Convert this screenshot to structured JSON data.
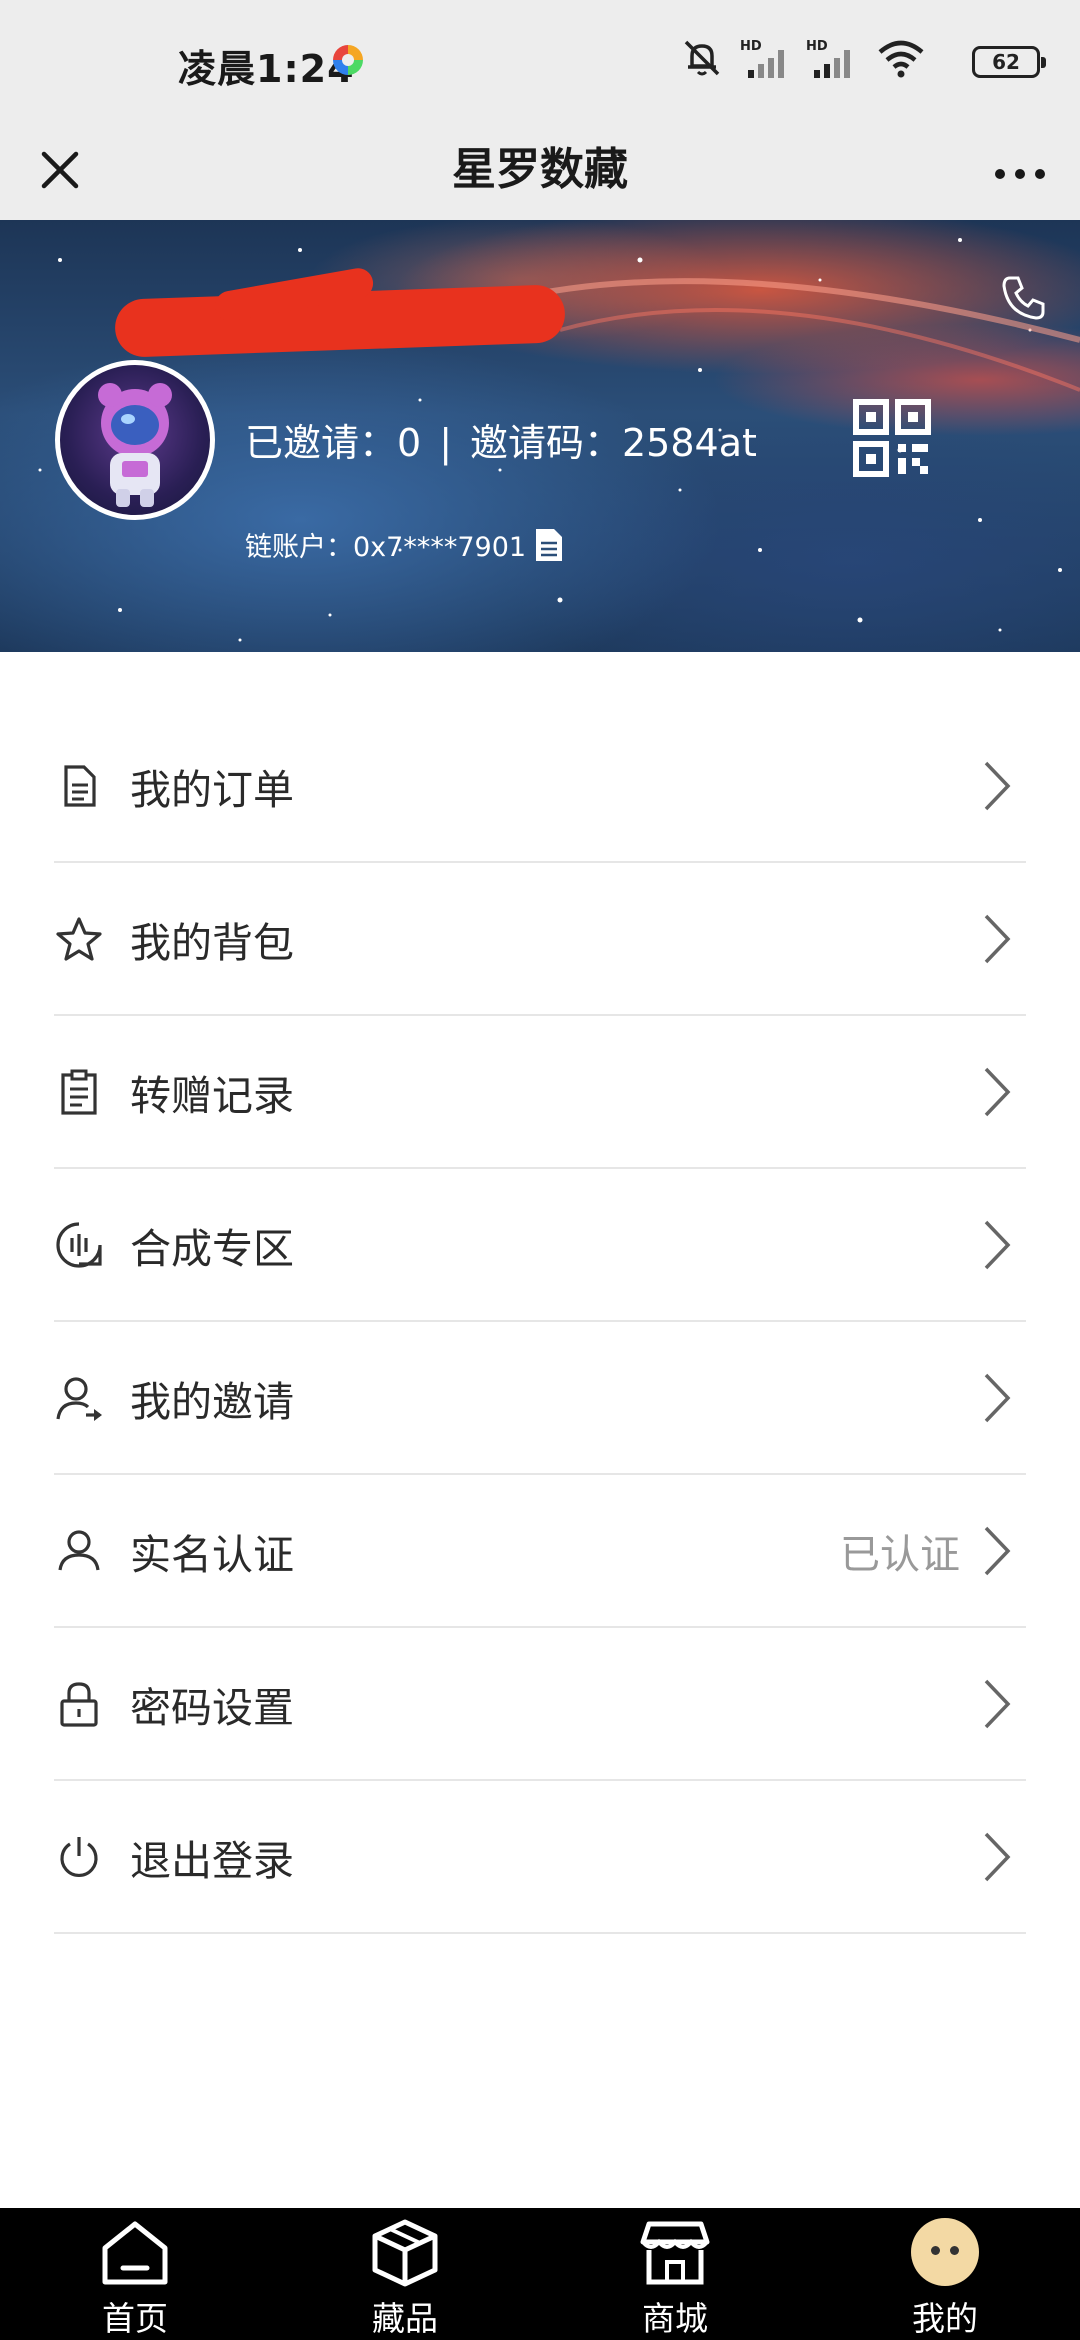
{
  "status_bar": {
    "time": "凌晨1:24",
    "battery": "62",
    "icons": [
      "app-dot-icon",
      "mute-icon",
      "signal-hd-icon",
      "signal-hd-icon-2",
      "wifi-icon",
      "battery-icon"
    ]
  },
  "title_bar": {
    "title": "星罗数藏",
    "close_icon": "close-icon",
    "more_icon": "more-icon"
  },
  "profile": {
    "invited_label": "已邀请：0",
    "separator": "|",
    "invite_code_label": "邀请码：2584at",
    "chain_account": "链账户：0x7****7901"
  },
  "menu": {
    "items": [
      {
        "label": "我的订单",
        "icon": "document-icon"
      },
      {
        "label": "我的背包",
        "icon": "star-icon"
      },
      {
        "label": "转赠记录",
        "icon": "clipboard-icon"
      },
      {
        "label": "合成专区",
        "icon": "synthesis-icon"
      },
      {
        "label": "我的邀请",
        "icon": "user-arrow-icon"
      },
      {
        "label": "实名认证",
        "icon": "user-icon",
        "status": "已认证"
      },
      {
        "label": "密码设置",
        "icon": "lock-icon"
      },
      {
        "label": "退出登录",
        "icon": "power-icon"
      }
    ]
  },
  "tab_bar": {
    "tabs": [
      {
        "label": "首页",
        "icon": "home-icon"
      },
      {
        "label": "藏品",
        "icon": "box-icon"
      },
      {
        "label": "商城",
        "icon": "store-icon"
      },
      {
        "label": "我的",
        "icon": "smile-icon"
      }
    ]
  }
}
